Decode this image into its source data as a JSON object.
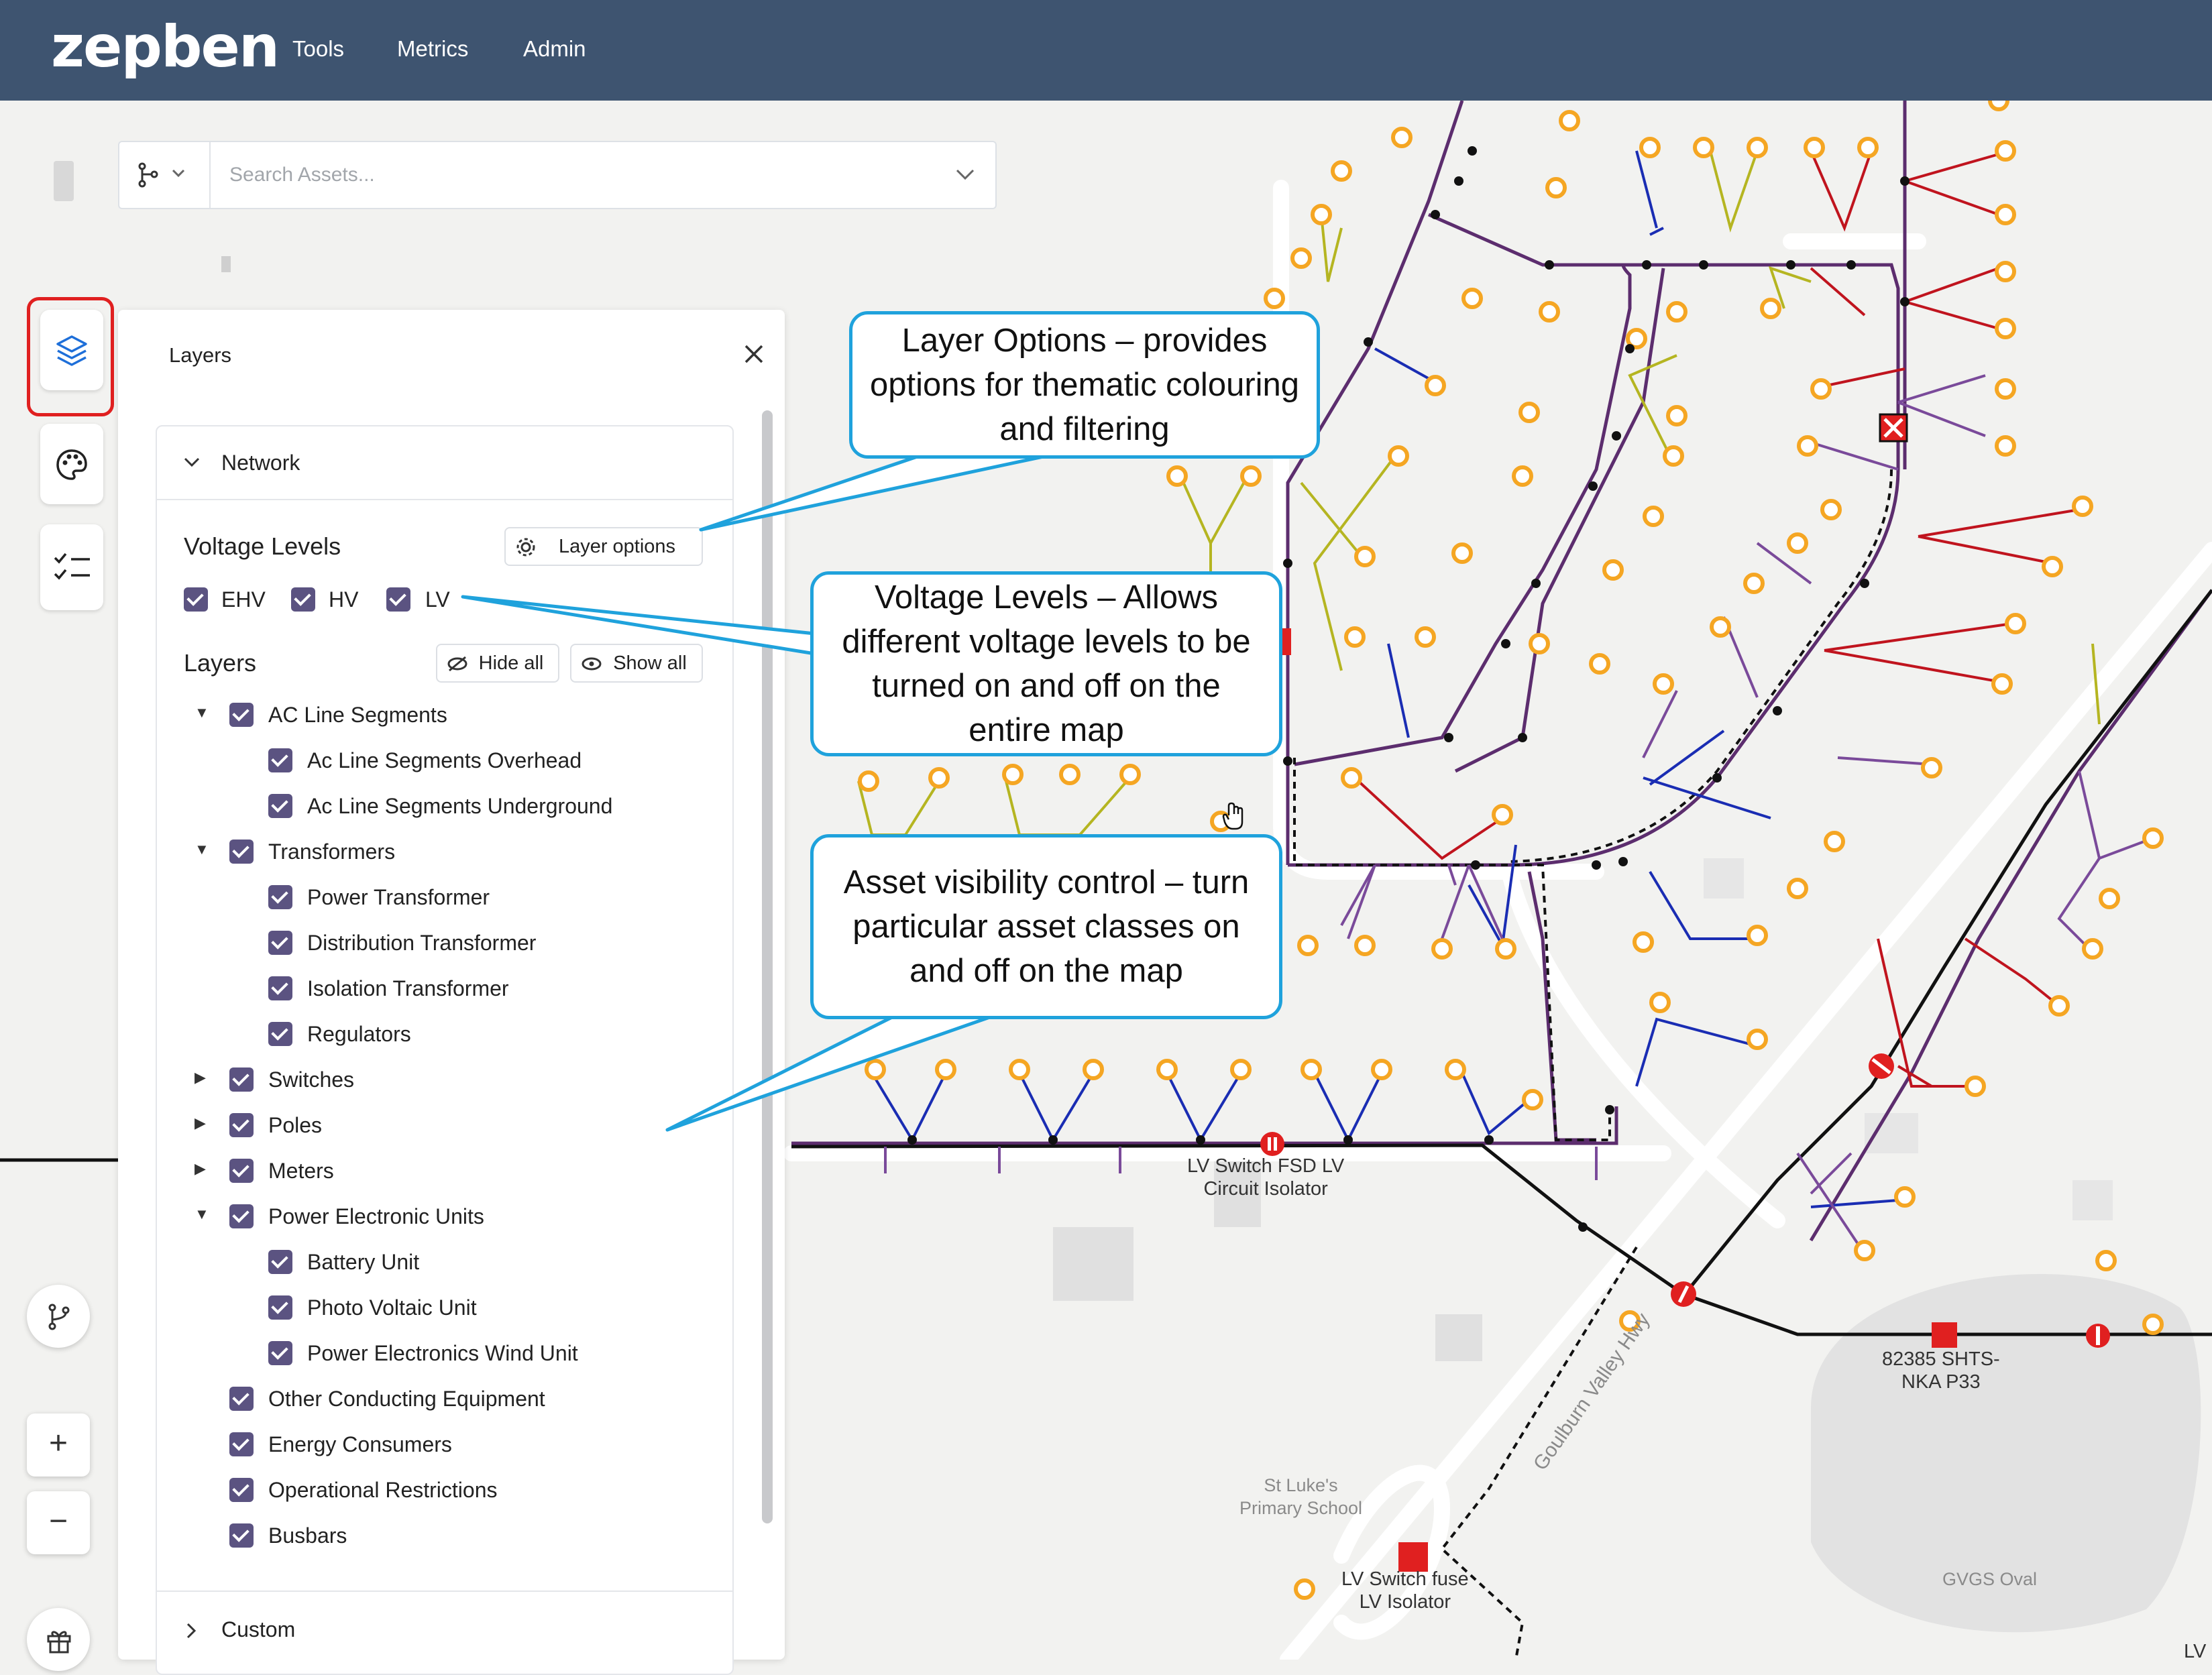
{
  "app": {
    "logo": "zepben",
    "nav": [
      "Tools",
      "Metrics",
      "Admin"
    ]
  },
  "search": {
    "placeholder": "Search Assets..."
  },
  "sidebar": {
    "buttons": [
      "layers-icon",
      "palette-icon",
      "checklist-icon"
    ],
    "bottom_buttons": [
      "branch-icon",
      "zoom-in",
      "zoom-out",
      "gift-icon"
    ],
    "zoom_in_label": "+",
    "zoom_out_label": "−"
  },
  "layers_panel": {
    "title": "Layers",
    "network_section": "Network",
    "voltage_heading": "Voltage Levels",
    "layer_options_label": "Layer options",
    "voltage_levels": [
      {
        "label": "EHV",
        "checked": true
      },
      {
        "label": "HV",
        "checked": true
      },
      {
        "label": "LV",
        "checked": true
      }
    ],
    "layers_heading": "Layers",
    "hide_all_label": "Hide all",
    "show_all_label": "Show all",
    "layers": [
      {
        "label": "AC Line Segments",
        "expanded": true,
        "level": 0
      },
      {
        "label": "Ac Line Segments Overhead",
        "level": 1
      },
      {
        "label": "Ac Line Segments Underground",
        "level": 1
      },
      {
        "label": "Transformers",
        "expanded": true,
        "level": 0
      },
      {
        "label": "Power Transformer",
        "level": 1
      },
      {
        "label": "Distribution Transformer",
        "level": 1
      },
      {
        "label": "Isolation Transformer",
        "level": 1
      },
      {
        "label": "Regulators",
        "level": 1
      },
      {
        "label": "Switches",
        "expanded": false,
        "level": 0
      },
      {
        "label": "Poles",
        "expanded": false,
        "level": 0
      },
      {
        "label": "Meters",
        "expanded": false,
        "level": 0
      },
      {
        "label": "Power Electronic Units",
        "expanded": true,
        "level": 0
      },
      {
        "label": "Battery Unit",
        "level": 1
      },
      {
        "label": "Photo Voltaic Unit",
        "level": 1
      },
      {
        "label": "Power Electronics Wind Unit",
        "level": 1
      },
      {
        "label": "Other Conducting Equipment",
        "level": 0
      },
      {
        "label": "Energy Consumers",
        "level": 0
      },
      {
        "label": "Operational Restrictions",
        "level": 0
      },
      {
        "label": "Busbars",
        "level": 0
      }
    ],
    "custom_section": "Custom"
  },
  "callouts": {
    "layer_options": "Layer Options – provides options for thematic colouring and filtering",
    "voltage_levels": "Voltage Levels – Allows different voltage levels to be turned on and off on the entire map",
    "asset_visibility": "Asset visibility control – turn particular asset classes on and off on the map"
  },
  "map_labels": {
    "lv_switch_1_line1": "LV Switch FSD LV",
    "lv_switch_1_line2": "Circuit Isolator",
    "pole_line1": "82385 SHTS-",
    "pole_line2": "NKA P33",
    "school_line1": "St Luke's",
    "school_line2": "Primary School",
    "road": "Goulburn Valley Hwy",
    "lv_switch_2_line1": "LV Switch fuse",
    "lv_switch_2_line2": "LV Isolator",
    "oval": "GVGS Oval",
    "edge_label": "LV"
  },
  "colors": {
    "topbar": "#3e5470",
    "checkbox": "#5b5381",
    "callout_border": "#1fa2dc",
    "highlight": "#e02020",
    "lv_line": "#5c2d6e",
    "consumer": "#f5a623",
    "yellow_line": "#b5b521",
    "blue_line": "#1a2db3",
    "red_line": "#c0141e"
  }
}
